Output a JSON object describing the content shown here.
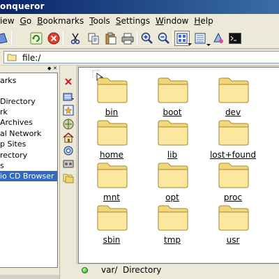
{
  "window": {
    "title": "onqueror"
  },
  "menubar": {
    "items": [
      {
        "pre": "",
        "ul": "",
        "post": "iew",
        "full": "iew"
      },
      {
        "pre": "",
        "ul": "G",
        "post": "o",
        "full": "Go"
      },
      {
        "pre": "",
        "ul": "B",
        "post": "ookmarks",
        "full": "Bookmarks"
      },
      {
        "pre": "",
        "ul": "T",
        "post": "ools",
        "full": "Tools"
      },
      {
        "pre": "",
        "ul": "S",
        "post": "ettings",
        "full": "Settings"
      },
      {
        "pre": "",
        "ul": "W",
        "post": "indow",
        "full": "Window"
      },
      {
        "pre": "",
        "ul": "H",
        "post": "elp",
        "full": "Help"
      }
    ]
  },
  "location": {
    "value": "file:/"
  },
  "sidebar": {
    "items": [
      {
        "label": "arks"
      },
      {
        "label": ""
      },
      {
        "label": "Directory"
      },
      {
        "label": "rk"
      },
      {
        "label": "Archives"
      },
      {
        "label": "al Network"
      },
      {
        "label": "p Sites"
      },
      {
        "label": "rectory"
      },
      {
        "label": "s"
      },
      {
        "label": "io CD Browser",
        "selected": true
      }
    ]
  },
  "files": [
    {
      "name": "bin"
    },
    {
      "name": "boot"
    },
    {
      "name": "dev"
    },
    {
      "name": "home"
    },
    {
      "name": "lib"
    },
    {
      "name": "lost+found"
    },
    {
      "name": "mnt"
    },
    {
      "name": "opt"
    },
    {
      "name": "proc"
    },
    {
      "name": "sbin"
    },
    {
      "name": "tmp"
    },
    {
      "name": "usr"
    }
  ],
  "status": {
    "text": "var/  Directory"
  },
  "colors": {
    "selection": "#316ac5",
    "folder": "#fbe79d",
    "title_bar": "#0a246a"
  },
  "icons": {
    "toolbar": [
      "view-icon",
      "reload-icon",
      "stop-icon",
      "cut-icon",
      "copy-icon",
      "paste-icon",
      "print-icon",
      "zoom-in-icon",
      "zoom-out-icon",
      "icon-view-icon",
      "detail-view-icon",
      "security-icon",
      "terminal-icon"
    ],
    "sidestrip": [
      "close-icon",
      "history-icon",
      "bookmarks-icon",
      "network-icon",
      "home-icon",
      "services-icon",
      "devices-icon",
      "folders-icon"
    ]
  }
}
